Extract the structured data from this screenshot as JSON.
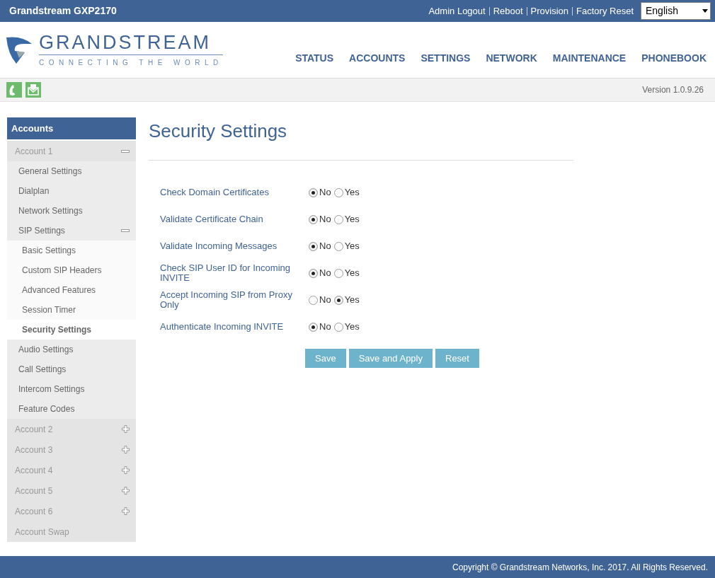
{
  "top_bar": {
    "title": "Grandstream GXP2170",
    "links": [
      "Admin Logout",
      "Reboot",
      "Provision",
      "Factory Reset"
    ],
    "language": "English"
  },
  "logo": {
    "name": "GRANDSTREAM",
    "tagline": "CONNECTING THE WORLD"
  },
  "nav": [
    {
      "label": "STATUS",
      "selected": false
    },
    {
      "label": "ACCOUNTS",
      "selected": false
    },
    {
      "label": "SETTINGS",
      "selected": false
    },
    {
      "label": "NETWORK",
      "selected": false
    },
    {
      "label": "MAINTENANCE",
      "selected": false
    },
    {
      "label": "PHONEBOOK",
      "selected": false
    }
  ],
  "version": "Version 1.0.9.26",
  "sidebar": {
    "title": "Accounts",
    "items": [
      {
        "label": "Account 1",
        "selected": false,
        "expanded": true,
        "children": [
          {
            "label": "General Settings",
            "selected": false
          },
          {
            "label": "Dialplan",
            "selected": false
          },
          {
            "label": "Network Settings",
            "selected": false
          },
          {
            "label": "SIP Settings",
            "selected": false,
            "expanded": true,
            "children": [
              {
                "label": "Basic Settings",
                "selected": false
              },
              {
                "label": "Custom SIP Headers",
                "selected": false
              },
              {
                "label": "Advanced Features",
                "selected": false
              },
              {
                "label": "Session Timer",
                "selected": false
              },
              {
                "label": "Security Settings",
                "selected": true
              }
            ]
          },
          {
            "label": "Audio Settings",
            "selected": false
          },
          {
            "label": "Call Settings",
            "selected": false
          },
          {
            "label": "Intercom Settings",
            "selected": false
          },
          {
            "label": "Feature Codes",
            "selected": false
          }
        ]
      },
      {
        "label": "Account 2",
        "selected": false,
        "expanded": false
      },
      {
        "label": "Account 3",
        "selected": false,
        "expanded": false
      },
      {
        "label": "Account 4",
        "selected": false,
        "expanded": false
      },
      {
        "label": "Account 5",
        "selected": false,
        "expanded": false
      },
      {
        "label": "Account 6",
        "selected": false,
        "expanded": false
      },
      {
        "label": "Account Swap",
        "selected": false
      }
    ]
  },
  "page_title": "Security Settings",
  "settings": [
    {
      "label": "Check Domain Certificates",
      "options": [
        {
          "label": "No",
          "selected": true
        },
        {
          "label": "Yes",
          "selected": false
        }
      ]
    },
    {
      "label": "Validate Certificate Chain",
      "options": [
        {
          "label": "No",
          "selected": true
        },
        {
          "label": "Yes",
          "selected": false
        }
      ]
    },
    {
      "label": "Validate Incoming Messages",
      "options": [
        {
          "label": "No",
          "selected": true
        },
        {
          "label": "Yes",
          "selected": false
        }
      ]
    },
    {
      "label": "Check SIP User ID for Incoming INVITE",
      "options": [
        {
          "label": "No",
          "selected": true
        },
        {
          "label": "Yes",
          "selected": false
        }
      ]
    },
    {
      "label": "Accept Incoming SIP from Proxy Only",
      "options": [
        {
          "label": "No",
          "selected": false
        },
        {
          "label": "Yes",
          "selected": true
        }
      ]
    },
    {
      "label": "Authenticate Incoming INVITE",
      "options": [
        {
          "label": "No",
          "selected": true
        },
        {
          "label": "Yes",
          "selected": false
        }
      ]
    }
  ],
  "buttons": [
    "Save",
    "Save and Apply",
    "Reset"
  ],
  "footer": "Copyright © Grandstream Networks, Inc. 2017. All Rights Reserved."
}
